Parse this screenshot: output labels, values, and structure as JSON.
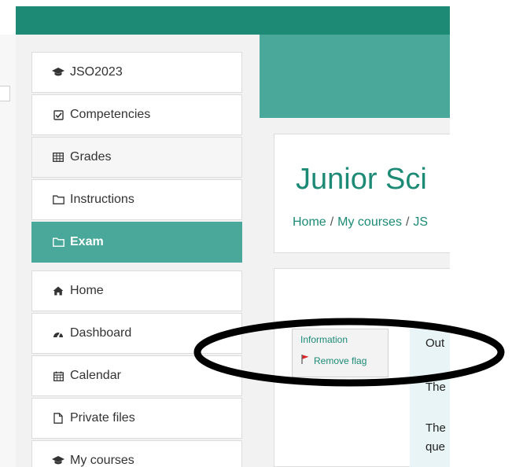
{
  "sidebar": {
    "course_items": [
      {
        "label": "JSO2023",
        "icon": "graduation-cap-icon"
      },
      {
        "label": "Competencies",
        "icon": "checkbox-icon"
      },
      {
        "label": "Grades",
        "icon": "table-icon"
      },
      {
        "label": "Instructions",
        "icon": "folder-icon"
      },
      {
        "label": "Exam",
        "icon": "folder-icon",
        "active": true
      }
    ],
    "site_items": [
      {
        "label": "Home",
        "icon": "home-icon"
      },
      {
        "label": "Dashboard",
        "icon": "dashboard-icon"
      },
      {
        "label": "Calendar",
        "icon": "calendar-icon"
      },
      {
        "label": "Private files",
        "icon": "file-icon"
      },
      {
        "label": "My courses",
        "icon": "graduation-cap-icon"
      }
    ]
  },
  "header": {
    "title": "Junior Sci",
    "breadcrumb": [
      "Home",
      "My courses",
      "JS"
    ],
    "breadcrumb_separator": "/"
  },
  "question": {
    "info_label": "Information",
    "remove_flag_label": "Remove flag",
    "text_lines": [
      "Out",
      "The",
      "The",
      "que"
    ]
  },
  "colors": {
    "topbar": "#1d8a76",
    "accent": "#4aa89a",
    "link": "#1d8a76",
    "flag": "#d9262b",
    "question_bg": "#e8f4f6"
  }
}
